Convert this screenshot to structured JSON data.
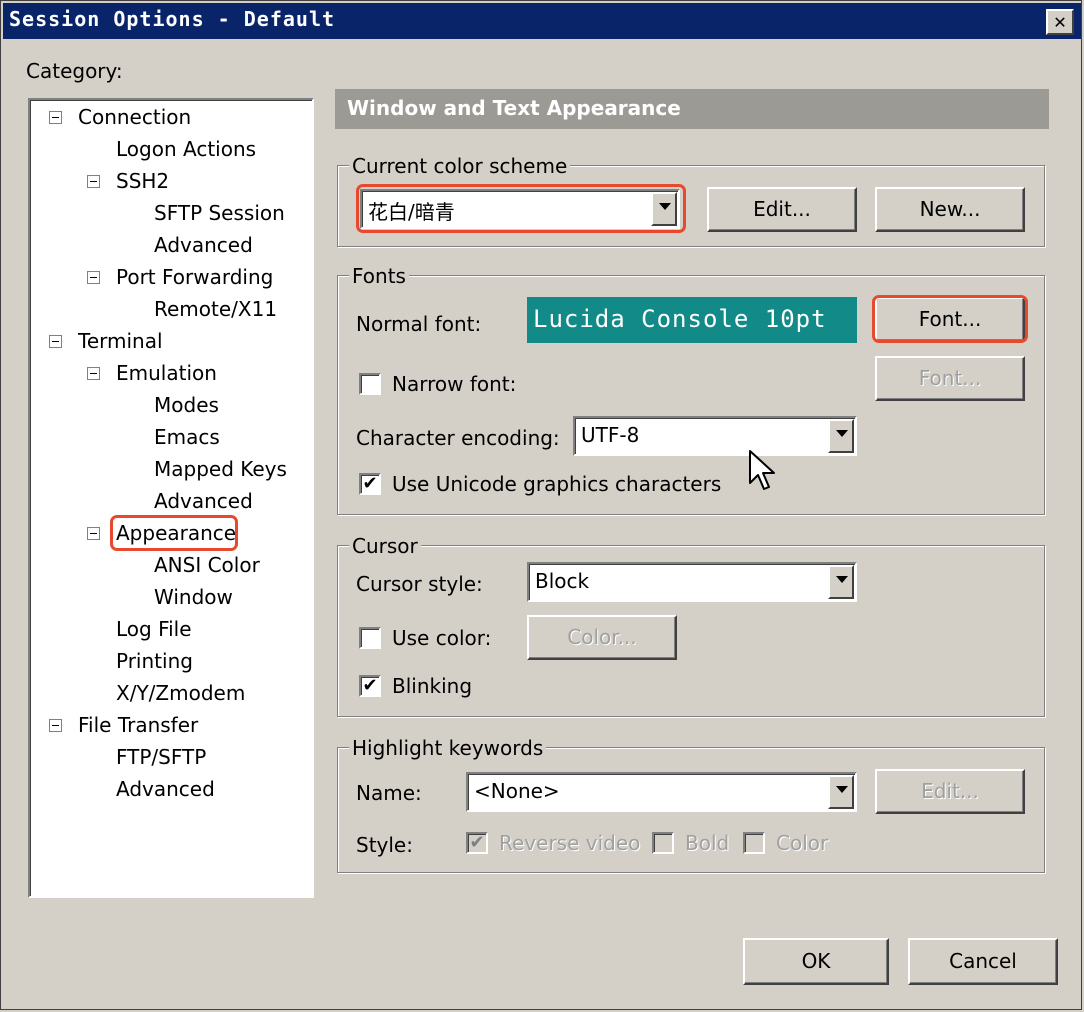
{
  "window": {
    "title": "Session Options - Default",
    "close_glyph": "✕"
  },
  "category_label": "Category:",
  "tree": [
    {
      "label": "Connection",
      "level": 0,
      "expander": true
    },
    {
      "label": "Logon Actions",
      "level": 1,
      "expander": false
    },
    {
      "label": "SSH2",
      "level": 1,
      "expander": true
    },
    {
      "label": "SFTP Session",
      "level": 2,
      "expander": false
    },
    {
      "label": "Advanced",
      "level": 2,
      "expander": false
    },
    {
      "label": "Port Forwarding",
      "level": 1,
      "expander": true
    },
    {
      "label": "Remote/X11",
      "level": 2,
      "expander": false
    },
    {
      "label": "Terminal",
      "level": 0,
      "expander": true
    },
    {
      "label": "Emulation",
      "level": 1,
      "expander": true
    },
    {
      "label": "Modes",
      "level": 2,
      "expander": false
    },
    {
      "label": "Emacs",
      "level": 2,
      "expander": false
    },
    {
      "label": "Mapped Keys",
      "level": 2,
      "expander": false
    },
    {
      "label": "Advanced",
      "level": 2,
      "expander": false
    },
    {
      "label": "Appearance",
      "level": 1,
      "expander": true,
      "selected": true
    },
    {
      "label": "ANSI Color",
      "level": 2,
      "expander": false
    },
    {
      "label": "Window",
      "level": 2,
      "expander": false
    },
    {
      "label": "Log File",
      "level": 1,
      "expander": false
    },
    {
      "label": "Printing",
      "level": 1,
      "expander": false
    },
    {
      "label": "X/Y/Zmodem",
      "level": 1,
      "expander": false
    },
    {
      "label": "File Transfer",
      "level": 0,
      "expander": true
    },
    {
      "label": "FTP/SFTP",
      "level": 1,
      "expander": false
    },
    {
      "label": "Advanced",
      "level": 1,
      "expander": false
    }
  ],
  "panel": {
    "header": "Window and Text Appearance",
    "color_scheme": {
      "group_title": "Current color scheme",
      "value": "花白/暗青",
      "edit_label": "Edit...",
      "new_label": "New..."
    },
    "fonts": {
      "group_title": "Fonts",
      "normal_font_label": "Normal font:",
      "normal_font_preview": "Lucida Console 10pt",
      "preview_bg": "#128a88",
      "font_button": "Font...",
      "narrow_font_label": "Narrow font:",
      "narrow_font_checked": false,
      "narrow_font_button": "Font...",
      "encoding_label": "Character encoding:",
      "encoding_value": "UTF-8",
      "unicode_label": "Use Unicode graphics characters",
      "unicode_checked": true
    },
    "cursor": {
      "group_title": "Cursor",
      "style_label": "Cursor style:",
      "style_value": "Block",
      "use_color_label": "Use color:",
      "use_color_checked": false,
      "color_button": "Color...",
      "blinking_label": "Blinking",
      "blinking_checked": true
    },
    "highlight": {
      "group_title": "Highlight keywords",
      "name_label": "Name:",
      "name_value": "<None>",
      "edit_button": "Edit...",
      "style_label": "Style:",
      "reverse_video_label": "Reverse video",
      "reverse_video_checked": true,
      "bold_label": "Bold",
      "bold_checked": false,
      "color_label": "Color",
      "color_checked": false
    }
  },
  "footer": {
    "ok_label": "OK",
    "cancel_label": "Cancel"
  },
  "colors": {
    "titlebar": "#0a246a",
    "face": "#d4d0c8",
    "annotation": "#e8492c"
  },
  "check_glyph": "✔"
}
